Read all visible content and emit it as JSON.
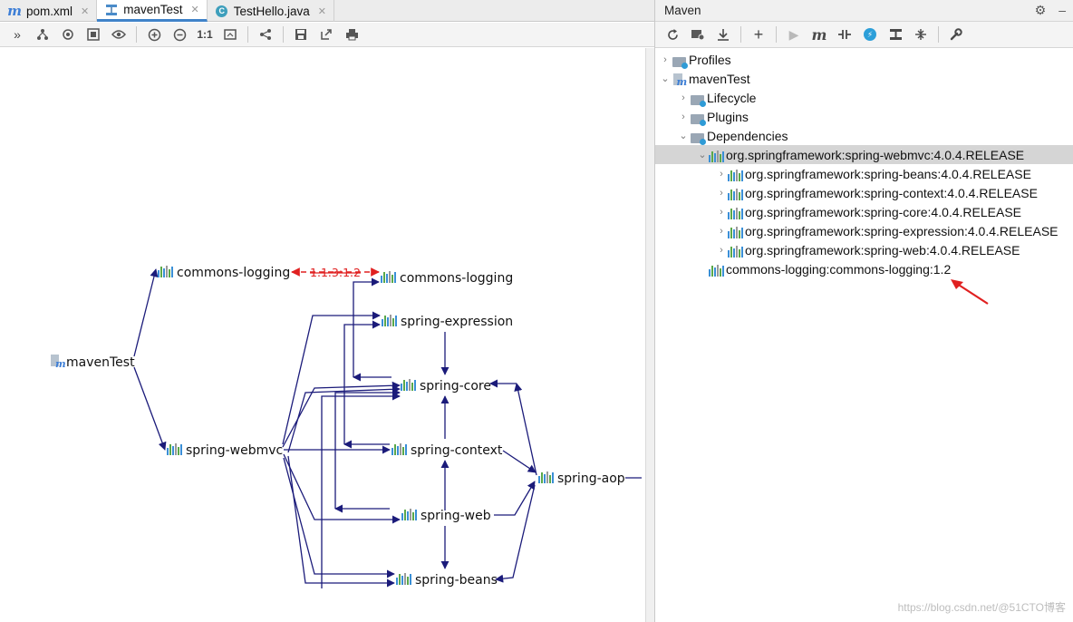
{
  "tabs": [
    {
      "label": "pom.xml",
      "icon": "maven-m-icon",
      "close": "✕"
    },
    {
      "label": "mavenTest",
      "icon": "diagram-icon",
      "close": "✕",
      "active": true
    },
    {
      "label": "TestHello.java",
      "icon": "java-class-icon",
      "close": "✕"
    }
  ],
  "graph_toolbar": {
    "zoom_actual_label": "1:1"
  },
  "graph": {
    "nodes": {
      "root": "mavenTest",
      "cl_outer": "commons-logging",
      "cl_inner": "commons-logging",
      "expression": "spring-expression",
      "core": "spring-core",
      "webmvc": "spring-webmvc",
      "context": "spring-context",
      "aop": "spring-aop",
      "web": "spring-web",
      "beans": "spring-beans"
    },
    "conflict_label": "1.1.3:1.2",
    "colors": {
      "edge": "#1b1b7a",
      "conflict": "#e02020",
      "bar_blue": "#3a8fd6",
      "bar_green": "#5aa84a",
      "bar_gray": "#9a9a9a"
    }
  },
  "maven": {
    "title": "Maven",
    "tree": [
      {
        "label": "Profiles",
        "arrow": "›",
        "icon": "profiles-folder-icon"
      },
      {
        "label": "mavenTest",
        "arrow": "⌄",
        "icon": "maven-project-icon"
      },
      {
        "label": "Lifecycle",
        "arrow": "›",
        "icon": "lifecycle-folder-icon"
      },
      {
        "label": "Plugins",
        "arrow": "›",
        "icon": "plugins-folder-icon"
      },
      {
        "label": "Dependencies",
        "arrow": "⌄",
        "icon": "dependencies-folder-icon"
      },
      {
        "label": "org.springframework:spring-webmvc:4.0.4.RELEASE",
        "arrow": "⌄",
        "icon": "library-icon"
      },
      {
        "label": "org.springframework:spring-beans:4.0.4.RELEASE",
        "arrow": "›",
        "icon": "library-icon"
      },
      {
        "label": "org.springframework:spring-context:4.0.4.RELEASE",
        "arrow": "›",
        "icon": "library-icon"
      },
      {
        "label": "org.springframework:spring-core:4.0.4.RELEASE",
        "arrow": "›",
        "icon": "library-icon"
      },
      {
        "label": "org.springframework:spring-expression:4.0.4.RELEASE",
        "arrow": "›",
        "icon": "library-icon"
      },
      {
        "label": "org.springframework:spring-web:4.0.4.RELEASE",
        "arrow": "›",
        "icon": "library-icon"
      },
      {
        "label": "commons-logging:commons-logging:1.2",
        "arrow": "",
        "icon": "library-icon"
      }
    ]
  },
  "watermark": "https://blog.csdn.net/@51CTO博客"
}
